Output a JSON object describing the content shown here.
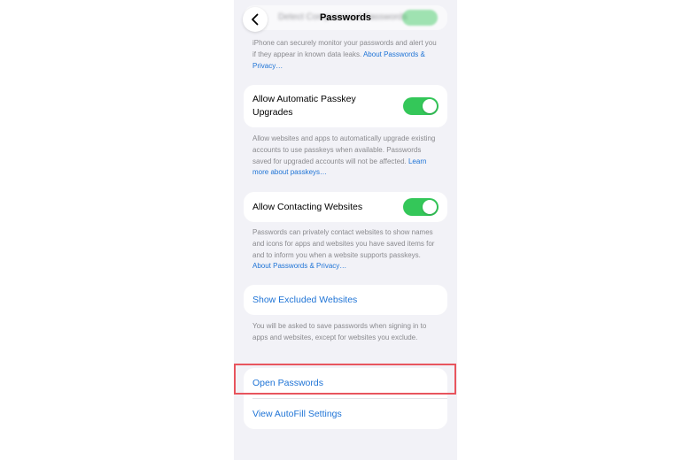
{
  "nav": {
    "title": "Passwords",
    "ghost_label": "Detect Compromised Passwords"
  },
  "sections": {
    "detect_footer": {
      "text": "iPhone can securely monitor your passwords and alert you if they appear in known data leaks. ",
      "link": "About Passwords & Privacy…"
    },
    "passkey": {
      "label": "Allow Automatic Passkey Upgrades",
      "footer_text": "Allow websites and apps to automatically upgrade existing accounts to use passkeys when available. Passwords saved for upgraded accounts will not be affected. ",
      "footer_link": "Learn more about passkeys…"
    },
    "contacting": {
      "label": "Allow Contacting Websites",
      "footer_text": "Passwords can privately contact websites to show names and icons for apps and websites you have saved items for and to inform you when a website supports passkeys. ",
      "footer_link": "About Passwords & Privacy…"
    },
    "excluded": {
      "label": "Show Excluded Websites",
      "footer_text": "You will be asked to save passwords when signing in to apps and websites, except for websites you exclude."
    },
    "bottom": {
      "open_passwords": "Open Passwords",
      "autofill": "View AutoFill Settings"
    }
  },
  "colors": {
    "toggle_on": "#34c759",
    "link": "#1f74d6",
    "highlight": "#e8555e"
  }
}
